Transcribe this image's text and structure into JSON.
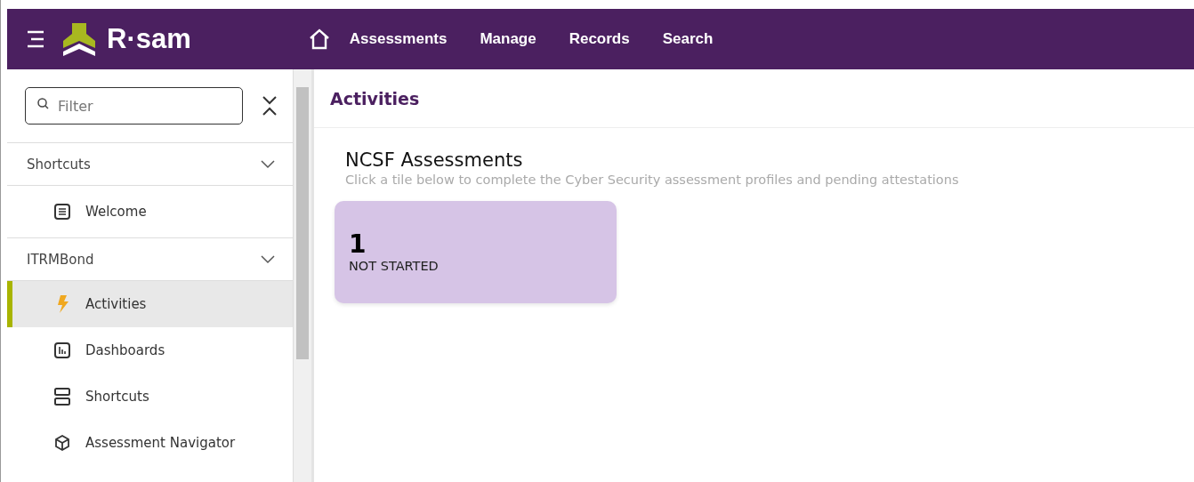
{
  "header": {
    "logo": "R·sam",
    "nav": [
      {
        "label": "Assessments"
      },
      {
        "label": "Manage"
      },
      {
        "label": "Records"
      },
      {
        "label": "Search"
      }
    ]
  },
  "sidebar": {
    "filter": {
      "placeholder": "Filter"
    },
    "groups": [
      {
        "label": "Shortcuts",
        "expanded": true,
        "items": [
          {
            "label": "Welcome",
            "kind": "document",
            "selected": false
          }
        ]
      },
      {
        "label": "ITRMBond",
        "expanded": true,
        "items": [
          {
            "label": "Activities",
            "kind": "bolt",
            "selected": true
          },
          {
            "label": "Dashboards",
            "kind": "chart",
            "selected": false
          },
          {
            "label": "Shortcuts",
            "kind": "stack",
            "selected": false
          },
          {
            "label": "Assessment Navigator",
            "kind": "cube",
            "selected": false
          }
        ]
      }
    ]
  },
  "page": {
    "title": "Activities",
    "section": {
      "title": "NCSF Assessments",
      "subtitle": "Click a tile below to complete the Cyber Security assessment profiles and pending attestations",
      "tiles": [
        {
          "count": "1",
          "status": "NOT STARTED"
        }
      ]
    }
  }
}
